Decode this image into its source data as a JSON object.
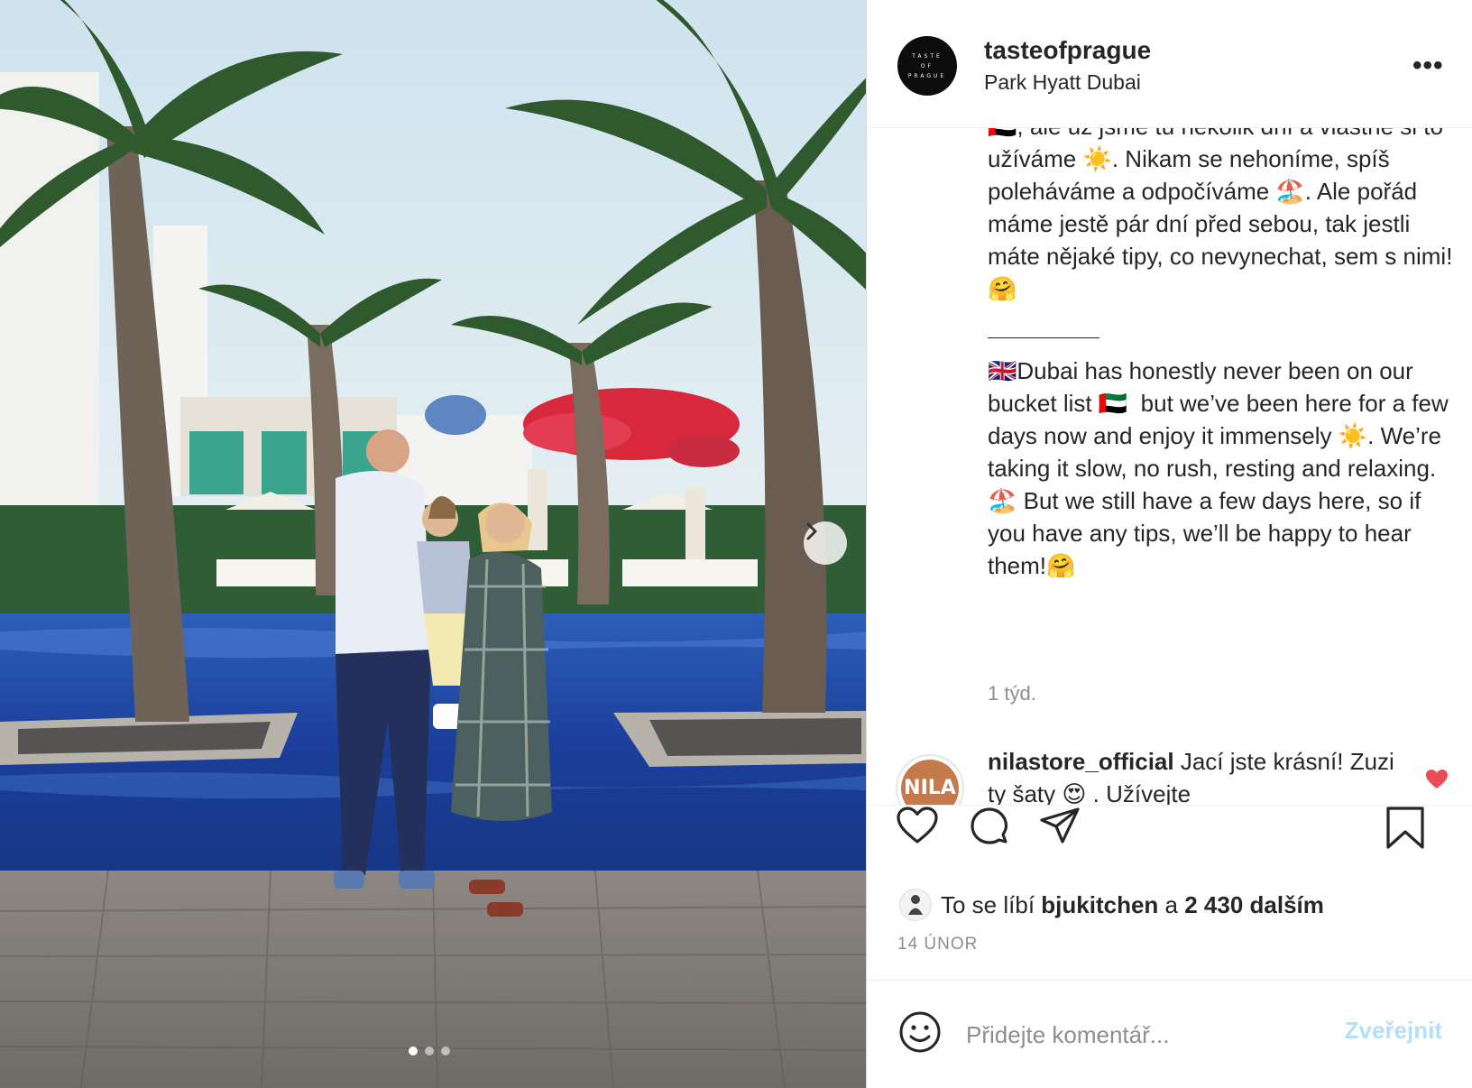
{
  "header": {
    "username": "tasteofprague",
    "location": "Park Hyatt Dubai",
    "avatar_text": [
      "TASTE",
      "OF",
      "PRAGUE"
    ],
    "more_label": "•••"
  },
  "caption": {
    "cz_paragraph": "🇦🇪, ale už jsme tu několik dní a vlastně si to užíváme ☀️. Nikam se nehoníme, spíš poleháváme a odpočíváme 🏖️. Ale pořád máme jestě pár dní před sebou, tak jestli máte nějaké tipy, co nevynechat, sem s nimi! 🤗",
    "en_paragraph": "🇬🇧Dubai has honestly never been on our bucket list 🇦🇪  but we’ve been here for a few days now and enjoy it immensely ☀️. We’re taking it slow, no rush, resting and relaxing. 🏖️ But we still have a few days here, so if you have any tips, we’ll be happy to hear them!🤗",
    "time_ago": "1 týd."
  },
  "comment": {
    "username": "nilastore_official",
    "text": " Jací jste krásní! Zuzi ty šaty 😍 . Užívejte",
    "avatar_text": "NILA"
  },
  "likes": {
    "prefix": "To se líbí ",
    "user": "bjukitchen",
    "middle": " a ",
    "count": "2 430 dalším"
  },
  "date": "14 ÚNOR",
  "add_comment": {
    "placeholder": "Přidejte komentář...",
    "post_label": "Zveřejnit"
  },
  "colors": {
    "like_red": "#ed4956",
    "text": "#262626",
    "muted": "#8e8e8e",
    "post_button_disabled": "#b2dffc"
  },
  "carousel": {
    "slides": 3,
    "active_slide": 1
  }
}
